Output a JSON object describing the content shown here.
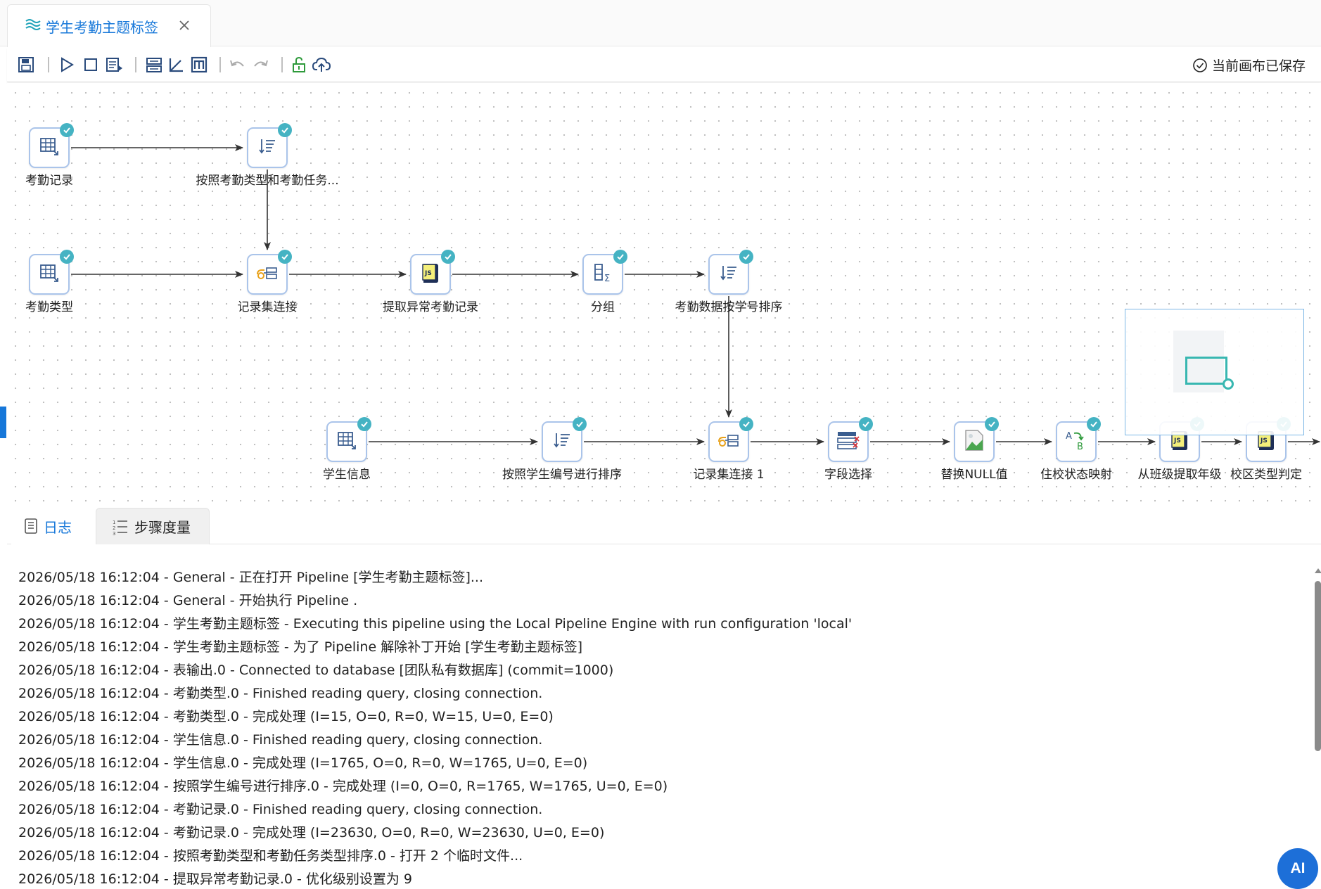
{
  "tab": {
    "title": "学生考勤主题标签",
    "icon": "layers-icon",
    "close_icon": "close-icon"
  },
  "toolbar": {
    "buttons": [
      {
        "name": "save-icon"
      },
      {
        "name": "run-icon"
      },
      {
        "name": "stop-icon"
      },
      {
        "name": "preview-icon"
      },
      {
        "name": "align-icon"
      },
      {
        "name": "angle-icon"
      },
      {
        "name": "m-icon"
      },
      {
        "name": "undo-icon"
      },
      {
        "name": "redo-icon"
      },
      {
        "name": "unlock-icon"
      },
      {
        "name": "upload-icon"
      }
    ],
    "status_text": "当前画布已保存"
  },
  "canvas": {
    "nodes": [
      {
        "id": "n1",
        "label": "考勤记录",
        "icon": "table-input-icon"
      },
      {
        "id": "n2",
        "label": "按照考勤类型和考勤任务...",
        "icon": "sort-icon"
      },
      {
        "id": "n3",
        "label": "考勤类型",
        "icon": "table-input-icon"
      },
      {
        "id": "n4",
        "label": "记录集连接",
        "icon": "join-icon"
      },
      {
        "id": "n5",
        "label": "提取异常考勤记录",
        "icon": "javascript-icon"
      },
      {
        "id": "n6",
        "label": "分组",
        "icon": "group-by-icon"
      },
      {
        "id": "n7",
        "label": "考勤数据按学号排序",
        "icon": "sort-icon"
      },
      {
        "id": "n8",
        "label": "学生信息",
        "icon": "table-input-icon"
      },
      {
        "id": "n9",
        "label": "按照学生编号进行排序",
        "icon": "sort-icon"
      },
      {
        "id": "n10",
        "label": "记录集连接 1",
        "icon": "join-icon"
      },
      {
        "id": "n11",
        "label": "字段选择",
        "icon": "select-fields-icon"
      },
      {
        "id": "n12",
        "label": "替换NULL值",
        "icon": "image-icon"
      },
      {
        "id": "n13",
        "label": "住校状态映射",
        "icon": "value-mapper-icon"
      },
      {
        "id": "n14",
        "label": "从班级提取年级",
        "icon": "javascript-icon"
      },
      {
        "id": "n15",
        "label": "校区类型判定",
        "icon": "javascript-icon"
      }
    ],
    "edges": [
      [
        "n1",
        "n2"
      ],
      [
        "n2",
        "n4"
      ],
      [
        "n3",
        "n4"
      ],
      [
        "n4",
        "n5"
      ],
      [
        "n5",
        "n6"
      ],
      [
        "n6",
        "n7"
      ],
      [
        "n7",
        "n10"
      ],
      [
        "n8",
        "n9"
      ],
      [
        "n9",
        "n10"
      ],
      [
        "n10",
        "n11"
      ],
      [
        "n11",
        "n12"
      ],
      [
        "n12",
        "n13"
      ],
      [
        "n13",
        "n14"
      ],
      [
        "n14",
        "n15"
      ]
    ],
    "status_badge_color": "#45b3c3"
  },
  "bottom_panel": {
    "tabs": [
      {
        "label": "日志",
        "icon": "log-icon",
        "active": true
      },
      {
        "label": "步骤度量",
        "icon": "metrics-icon",
        "active": false
      }
    ],
    "log_lines": [
      "2026/05/18 16:12:04 - General - 正在打开 Pipeline [学生考勤主题标签]...",
      "2026/05/18 16:12:04 - General - 开始执行 Pipeline .",
      "2026/05/18 16:12:04 - 学生考勤主题标签 - Executing this pipeline using the Local Pipeline Engine with run configuration 'local'",
      "2026/05/18 16:12:04 - 学生考勤主题标签 - 为了 Pipeline 解除补丁开始 [学生考勤主题标签]",
      "2026/05/18 16:12:04 - 表输出.0 - Connected to database [团队私有数据库] (commit=1000)",
      "2026/05/18 16:12:04 - 考勤类型.0 - Finished reading query, closing connection.",
      "2026/05/18 16:12:04 - 考勤类型.0 - 完成处理 (I=15, O=0, R=0, W=15, U=0, E=0)",
      "2026/05/18 16:12:04 - 学生信息.0 - Finished reading query, closing connection.",
      "2026/05/18 16:12:04 - 学生信息.0 - 完成处理 (I=1765, O=0, R=0, W=1765, U=0, E=0)",
      "2026/05/18 16:12:04 - 按照学生编号进行排序.0 - 完成处理 (I=0, O=0, R=1765, W=1765, U=0, E=0)",
      "2026/05/18 16:12:04 - 考勤记录.0 - Finished reading query, closing connection.",
      "2026/05/18 16:12:04 - 考勤记录.0 - 完成处理 (I=23630, O=0, R=0, W=23630, U=0, E=0)",
      "2026/05/18 16:12:04 - 按照考勤类型和考勤任务类型排序.0 - 打开 2 个临时文件...",
      "2026/05/18 16:12:04 - 提取异常考勤记录.0 - 优化级别设置为 9"
    ]
  },
  "ai_button": {
    "label": "AI"
  },
  "colors": {
    "accent": "#1677d9",
    "node_border": "#aac4ea",
    "minimap_view": "#38b7b1"
  }
}
